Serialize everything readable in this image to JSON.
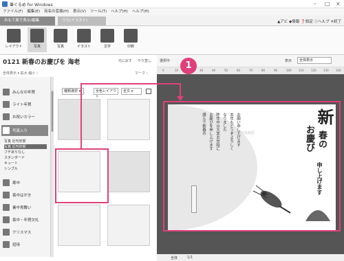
{
  "window": {
    "title": "筆ぐるめ for Windows",
    "controls": [
      "–",
      "□",
      "×"
    ]
  },
  "menu": [
    "ファイル(F)",
    "編集(E)",
    "宛名の変換(H)",
    "表示(V)",
    "ツール(T)",
    "ヘルプ(H)",
    "ヘルプ(H)"
  ],
  "tabs": {
    "active": "おもて面で表示/編集",
    "inactive": "うら(イラスト)"
  },
  "top_links": "▲アビ ◆情報 ❓設定 ⓘヘルプ ✕終了",
  "toolbar": [
    {
      "label": "レイアウト",
      "icon": "layout-icon"
    },
    {
      "label": "写真",
      "icon": "photo-icon",
      "selected": true
    },
    {
      "label": "写真",
      "icon": "photo2-icon"
    },
    {
      "label": "イラスト",
      "icon": "illust-icon"
    },
    {
      "label": "文字",
      "icon": "text-icon"
    },
    {
      "label": "印刷",
      "icon": "print-icon"
    }
  ],
  "header": {
    "title": "0121 新春のお慶びを 海老",
    "btn1": "元に戻す",
    "btn2": "やり直し"
  },
  "subbar": {
    "left": "全体表示 ▾ 拡大 縮小 ‹",
    "right": "マーク ›"
  },
  "sidebar": [
    {
      "label": "みんなの年賀",
      "icon": "card-icon"
    },
    {
      "label": "ライト年賀",
      "icon": "light-icon"
    },
    {
      "label": "お祝いカラー",
      "icon": "color-icon"
    },
    {
      "label": "写真入り",
      "icon": "photo-icon",
      "selected": true
    }
  ],
  "sidebar_sub": [
    "写真 近刊年賀",
    "写真 近刊年賀",
    "フチありなし",
    "スタンダード",
    "キュート",
    "シンプル"
  ],
  "sidebar_bottom": [
    {
      "label": "寒中",
      "icon": "winter-icon"
    },
    {
      "label": "喪中はがき",
      "icon": "mourning-icon"
    },
    {
      "label": "暑中見舞い",
      "icon": "summer-icon"
    },
    {
      "label": "喪中・年賀欠礼",
      "icon": "notice-icon"
    },
    {
      "label": "クリスマス",
      "icon": "xmas-icon"
    },
    {
      "label": "招待",
      "icon": "invite-icon"
    }
  ],
  "filters": {
    "f1": "種類選択 ▾",
    "f2": "全色レイアウト",
    "f3": "全文 ▾"
  },
  "canvas_bar": {
    "l1": "選択中",
    "l2": "表示",
    "field": "全体表示"
  },
  "ruler_ticks": [
    "0",
    "10",
    "20",
    "30",
    "40",
    "50",
    "60",
    "70",
    "80",
    "90",
    "100",
    "110",
    "120",
    "130",
    "140"
  ],
  "card": {
    "label": "印刷可能範囲",
    "body_text": [
      "謹んで新春の",
      "お慶びを申し上げます",
      "昨年中は大変お世話に",
      "なりました",
      "本年もどうぞよろしく",
      "お願い申し上げます"
    ],
    "calligraphy_big": "新",
    "calligraphy_2": "春の",
    "calligraphy_3": "お慶び",
    "calligraphy_4": "申し上げます"
  },
  "bottom": {
    "zoom": "全体",
    "page": "1/1"
  },
  "callout": "1",
  "colors": {
    "accent": "#e0407a"
  }
}
